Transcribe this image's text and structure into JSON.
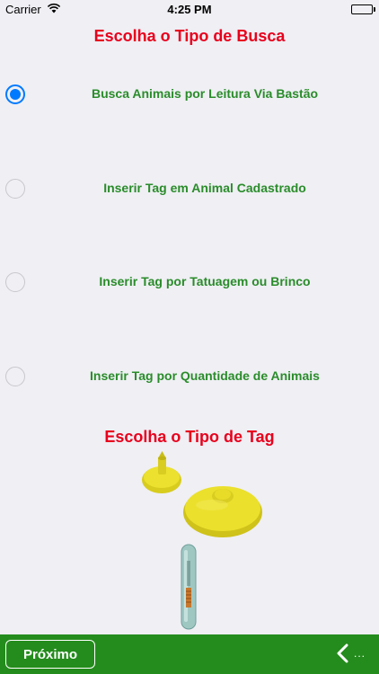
{
  "status_bar": {
    "carrier": "Carrier",
    "time": "4:25 PM",
    "battery_level": 1.0
  },
  "search_section": {
    "title": "Escolha o Tipo de Busca",
    "options": [
      {
        "label": "Busca Animais por Leitura Via Bastão",
        "selected": true
      },
      {
        "label": "Inserir Tag em Animal Cadastrado",
        "selected": false
      },
      {
        "label": "Inserir Tag por Tatuagem ou Brinco",
        "selected": false
      },
      {
        "label": "Inserir Tag por Quantidade de Animais",
        "selected": false
      }
    ]
  },
  "tag_section": {
    "title": "Escolha o Tipo de Tag",
    "images": [
      "yellow-ear-tag-image",
      "glass-capsule-tag-image"
    ]
  },
  "footer": {
    "next_label": "Próximo",
    "back_dots": "...",
    "icons": [
      "chevron-left-icon"
    ]
  },
  "colors": {
    "title_red": "#e8001c",
    "option_green": "#2a8c2a",
    "footer_green": "#248c1c",
    "radio_blue": "#007aff",
    "background": "#efeff4"
  }
}
